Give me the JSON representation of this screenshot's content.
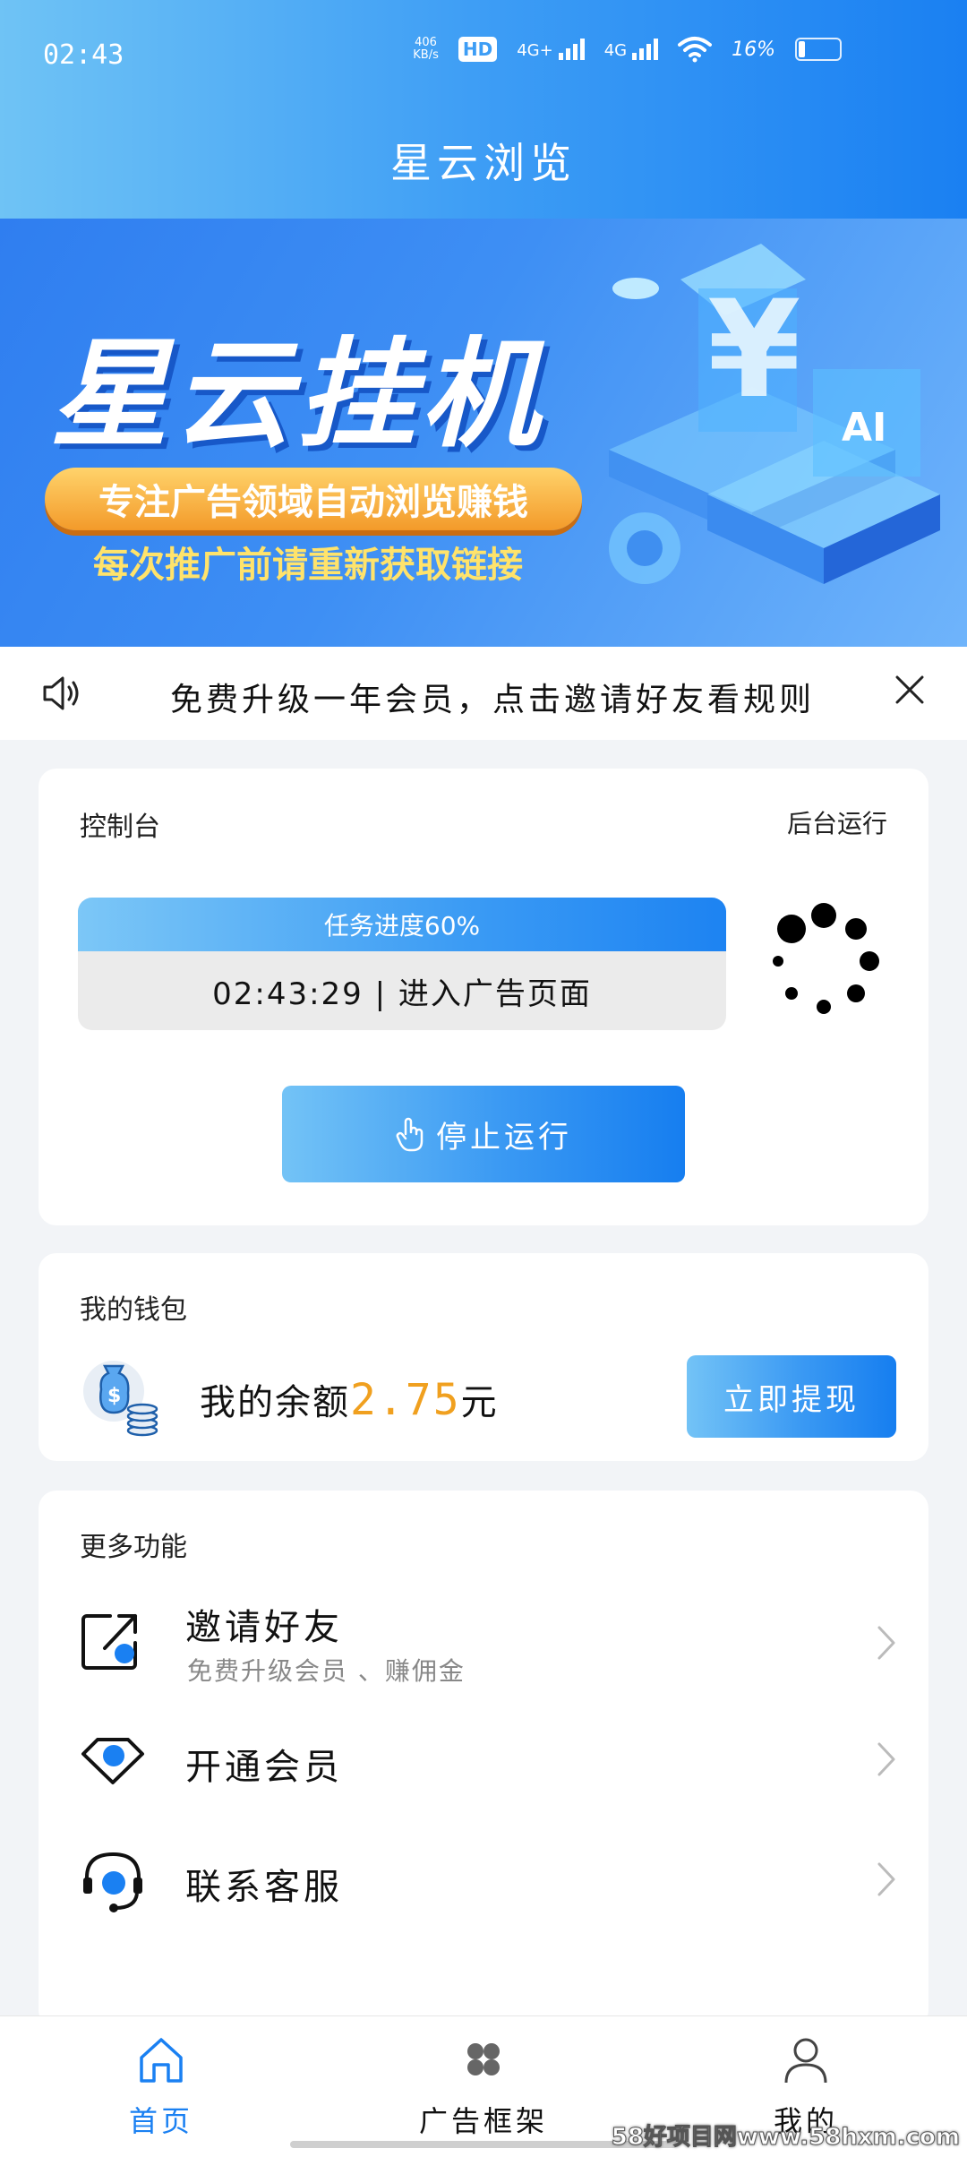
{
  "status_bar": {
    "time": "02:43",
    "net_speed_value": "406",
    "net_speed_unit": "KB/s",
    "hd": "HD",
    "network_1": "4G+",
    "network_2": "4G",
    "battery_text": "16%",
    "battery_level": 0.16
  },
  "header": {
    "title": "星云浏览"
  },
  "banner": {
    "title": "星云挂机",
    "pill_text": "专注广告领域自动浏览赚钱",
    "sub_text": "每次推广前请重新获取链接"
  },
  "notice": {
    "text": "免费升级一年会员，点击邀请好友看规则"
  },
  "console": {
    "title": "控制台",
    "background_run": "后台运行",
    "progress_label": "任务进度60%",
    "progress_value": 0.6,
    "status_line": "02:43:29 | 进入广告页面",
    "stop_button": "停止运行"
  },
  "wallet": {
    "title": "我的钱包",
    "balance_prefix": "我的余额",
    "balance_amount": "2.75",
    "balance_unit": "元",
    "withdraw_button": "立即提现"
  },
  "more": {
    "title": "更多功能",
    "items": [
      {
        "label": "邀请好友",
        "sub": "免费升级会员 、赚佣金",
        "icon": "share-icon"
      },
      {
        "label": "开通会员",
        "sub": "",
        "icon": "vip-diamond-icon"
      },
      {
        "label": "联系客服",
        "sub": "",
        "icon": "headset-icon"
      }
    ]
  },
  "bottom_nav": {
    "items": [
      {
        "label": "首页",
        "icon": "home-icon",
        "active": true
      },
      {
        "label": "广告框架",
        "icon": "clover-icon",
        "active": false
      },
      {
        "label": "我的",
        "icon": "user-icon",
        "active": false
      }
    ]
  },
  "watermark": "58好项目网www.58hxm.com",
  "colors": {
    "primary": "#1a80f2",
    "primary_light": "#6fc3f5",
    "amount": "#f0a01f",
    "nav_active": "#1a80f2"
  }
}
